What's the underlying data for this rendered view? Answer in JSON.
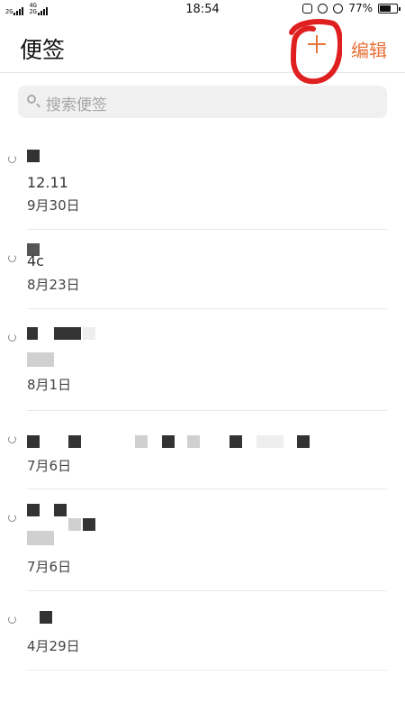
{
  "status_bar": {
    "signal1_label": "2G",
    "signal2_label_top": "4G",
    "signal2_label_bottom": "2G",
    "time": "18:54",
    "battery_percent": "77%",
    "battery_level": 0.77
  },
  "header": {
    "title": "便签",
    "add_label": "+",
    "edit_label": "编辑"
  },
  "search": {
    "placeholder": "搜索便签"
  },
  "notes": [
    {
      "title": "",
      "subtitle": "12.11",
      "date": "9月30日"
    },
    {
      "title": "4c",
      "date": "8月23日"
    },
    {
      "title": "",
      "date": "8月1日"
    },
    {
      "title": "",
      "date": "7月6日"
    },
    {
      "title": "",
      "date": "7月6日"
    },
    {
      "title": "",
      "date": "4月29日"
    }
  ],
  "colors": {
    "accent": "#e8733a",
    "annotation": "#e02020"
  }
}
